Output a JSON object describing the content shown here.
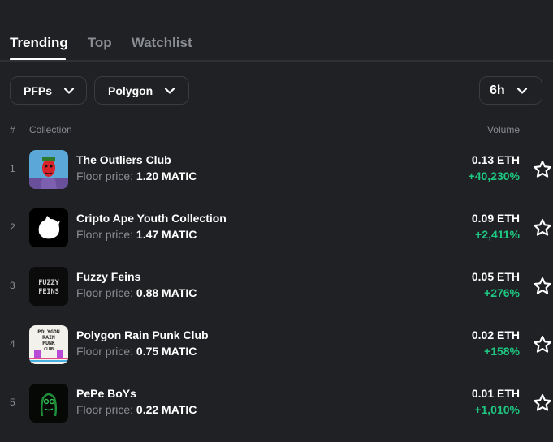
{
  "tabs": [
    {
      "label": "Trending",
      "active": true
    },
    {
      "label": "Top",
      "active": false
    },
    {
      "label": "Watchlist",
      "active": false
    }
  ],
  "filters": {
    "category": {
      "value": "PFPs",
      "icon": "chevron-down-icon"
    },
    "chain": {
      "value": "Polygon",
      "icon": "chevron-down-icon"
    },
    "timeframe": {
      "value": "6h",
      "icon": "chevron-down-icon"
    }
  },
  "table": {
    "headers": {
      "rank": "#",
      "collection": "Collection",
      "volume": "Volume"
    },
    "floor_label": "Floor price:",
    "rows": [
      {
        "rank": "1",
        "name": "The Outliers Club",
        "floor": "1.20 MATIC",
        "volume": "0.13 ETH",
        "change": "+40,230%",
        "thumb": "outliers"
      },
      {
        "rank": "2",
        "name": "Cripto Ape Youth Collection",
        "floor": "1.47 MATIC",
        "volume": "0.09 ETH",
        "change": "+2,411%",
        "thumb": "ape"
      },
      {
        "rank": "3",
        "name": "Fuzzy Feins",
        "floor": "0.88 MATIC",
        "volume": "0.05 ETH",
        "change": "+276%",
        "thumb": "fuzzy"
      },
      {
        "rank": "4",
        "name": "Polygon Rain Punk Club",
        "floor": "0.75 MATIC",
        "volume": "0.02 ETH",
        "change": "+158%",
        "thumb": "rainpunk"
      },
      {
        "rank": "5",
        "name": "PePe BoYs",
        "floor": "0.22 MATIC",
        "volume": "0.01 ETH",
        "change": "+1,010%",
        "thumb": "pepe"
      }
    ]
  },
  "thumb_text": {
    "fuzzy": "FUZZY FEINS",
    "rainpunk": "POLYGON RAIN PUNK CLUB"
  },
  "colors": {
    "background": "#202124",
    "positive": "#1ec782",
    "muted": "#8a8d93"
  },
  "icons": {
    "watch": "star-outline-icon"
  }
}
